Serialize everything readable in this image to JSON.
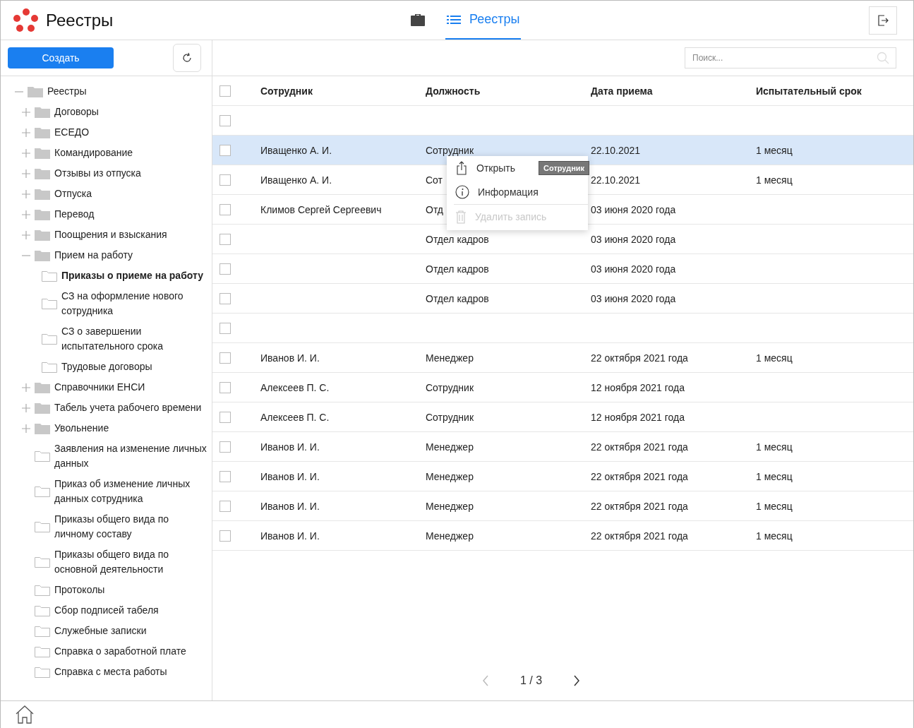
{
  "app": {
    "title": "Реестры"
  },
  "tabs": [
    {
      "kind": "briefcase",
      "selected": false
    },
    {
      "kind": "list",
      "label": "Реестры",
      "selected": true
    }
  ],
  "sidebar": {
    "create_button": "Создать",
    "tree": [
      {
        "label": "Реестры",
        "expanded": true,
        "selected": false,
        "children": [
          {
            "kind": "group",
            "label": "Договоры",
            "expanded": false,
            "selected": false
          },
          {
            "kind": "group",
            "label": "ЕСЕДО",
            "expanded": false,
            "selected": false
          },
          {
            "kind": "group",
            "label": "Командирование",
            "expanded": false,
            "selected": false
          },
          {
            "kind": "group",
            "label": "Отзывы из отпуска",
            "expanded": false,
            "selected": false
          },
          {
            "kind": "group",
            "label": "Отпуска",
            "expanded": false,
            "selected": false
          },
          {
            "kind": "group",
            "label": "Перевод",
            "expanded": false,
            "selected": false
          },
          {
            "kind": "group",
            "label": "Поощрения и взыскания",
            "expanded": false,
            "selected": false
          },
          {
            "kind": "group",
            "label": "Прием на работу",
            "expanded": true,
            "selected": false,
            "children": [
              {
                "label": "Приказы о приеме на работу",
                "selected": true
              },
              {
                "label": "СЗ на оформление нового сотрудника",
                "selected": false
              },
              {
                "label": "СЗ о завершении испытательного срока",
                "selected": false
              },
              {
                "label": "Трудовые договоры",
                "selected": false
              }
            ]
          },
          {
            "kind": "group",
            "label": "Справочники ЕНСИ",
            "expanded": false,
            "selected": false
          },
          {
            "kind": "group",
            "label": "Табель учета рабочего времени",
            "expanded": false,
            "selected": false
          },
          {
            "kind": "group",
            "label": "Увольнение",
            "expanded": false,
            "selected": false
          },
          {
            "label": "Заявления на изменение личных данных",
            "selected": false
          },
          {
            "label": "Приказ об изменение личных данных сотрудника",
            "selected": false
          },
          {
            "label": "Приказы общего вида по личному составу",
            "selected": false
          },
          {
            "label": "Приказы общего вида по основной деятельности",
            "selected": false
          },
          {
            "label": "Протоколы",
            "selected": false
          },
          {
            "label": "Сбор подписей табеля",
            "selected": false
          },
          {
            "label": "Служебные записки",
            "selected": false
          },
          {
            "label": "Справка о заработной плате",
            "selected": false
          },
          {
            "label": "Справка с места работы",
            "selected": false
          }
        ]
      }
    ]
  },
  "search": {
    "placeholder": "Поиск..."
  },
  "table": {
    "select_all_checked": false,
    "columns": [
      "Сотрудник",
      "Должность",
      "Дата приема",
      "Испытательный срок"
    ],
    "rows": [
      {
        "cells": [],
        "selected": false,
        "checked": false
      },
      {
        "cells": [
          "Иващенко А. И.",
          "Сотрудник",
          "22.10.2021",
          "1 месяц"
        ],
        "selected": true,
        "checked": false
      },
      {
        "cells": [
          "Иващенко А. И.",
          "Сот",
          "22.10.2021",
          "1 месяц"
        ],
        "selected": false,
        "checked": false
      },
      {
        "cells": [
          "Климов Сергей Сергеевич",
          "Отд",
          "03 июня 2020 года",
          ""
        ],
        "selected": false,
        "checked": false
      },
      {
        "cells": [
          "",
          "Отдел кадров",
          "03 июня 2020 года",
          ""
        ],
        "selected": false,
        "checked": false
      },
      {
        "cells": [
          "",
          "Отдел кадров",
          "03 июня 2020 года",
          ""
        ],
        "selected": false,
        "checked": false
      },
      {
        "cells": [
          "",
          "Отдел кадров",
          "03 июня 2020 года",
          ""
        ],
        "selected": false,
        "checked": false
      },
      {
        "cells": [],
        "selected": false,
        "checked": false
      },
      {
        "cells": [
          "Иванов И. И.",
          "Менеджер",
          "22 октября 2021 года",
          "1 месяц"
        ],
        "selected": false,
        "checked": false
      },
      {
        "cells": [
          "Алексеев П. С.",
          "Сотрудник",
          "12 ноября 2021 года",
          ""
        ],
        "selected": false,
        "checked": false
      },
      {
        "cells": [
          "Алексеев П. С.",
          "Сотрудник",
          "12 ноября 2021 года",
          ""
        ],
        "selected": false,
        "checked": false
      },
      {
        "cells": [
          "Иванов И. И.",
          "Менеджер",
          "22 октября 2021 года",
          "1 месяц"
        ],
        "selected": false,
        "checked": false
      },
      {
        "cells": [
          "Иванов И. И.",
          "Менеджер",
          "22 октября 2021 года",
          "1 месяц"
        ],
        "selected": false,
        "checked": false
      },
      {
        "cells": [
          "Иванов И. И.",
          "Менеджер",
          "22 октября 2021 года",
          "1 месяц"
        ],
        "selected": false,
        "checked": false
      },
      {
        "cells": [
          "Иванов И. И.",
          "Менеджер",
          "22 октября 2021 года",
          "1 месяц"
        ],
        "selected": false,
        "checked": false
      }
    ]
  },
  "context_menu": {
    "items": [
      {
        "kind": "open",
        "label": "Открыть",
        "disabled": false
      },
      {
        "kind": "info",
        "label": "Информация",
        "disabled": false
      },
      {
        "kind": "delete",
        "label": "Удалить запись",
        "disabled": true
      }
    ],
    "tooltip": "Сотрудник"
  },
  "pagination": {
    "text": "1 / 3",
    "prev_disabled": true,
    "next_disabled": false
  }
}
